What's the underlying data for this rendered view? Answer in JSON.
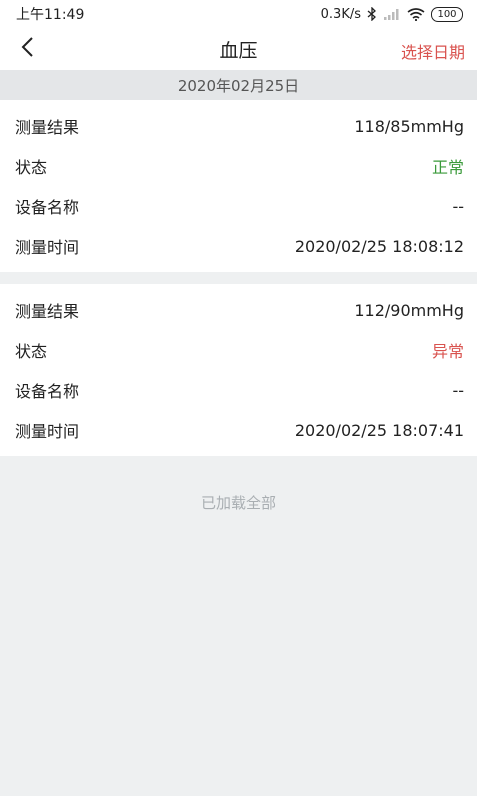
{
  "status_bar": {
    "time": "上午11:49",
    "network_speed": "0.3K/s",
    "battery": "100"
  },
  "nav": {
    "title": "血压",
    "right_action": "选择日期"
  },
  "date_header": "2020年02月25日",
  "records": [
    {
      "result_label": "测量结果",
      "result_value": "118/85mmHg",
      "status_label": "状态",
      "status_value": "正常",
      "status_color": "#3a9a3a",
      "device_label": "设备名称",
      "device_value": "--",
      "time_label": "测量时间",
      "time_value": "2020/02/25 18:08:12"
    },
    {
      "result_label": "测量结果",
      "result_value": "112/90mmHg",
      "status_label": "状态",
      "status_value": "异常",
      "status_color": "#d9534f",
      "device_label": "设备名称",
      "device_value": "--",
      "time_label": "测量时间",
      "time_value": "2020/02/25 18:07:41"
    }
  ],
  "footer": "已加载全部",
  "icons": {
    "back": "chevron-left-icon",
    "bluetooth": "bluetooth-icon",
    "signal": "signal-icon",
    "wifi": "wifi-icon",
    "battery": "battery-icon"
  }
}
